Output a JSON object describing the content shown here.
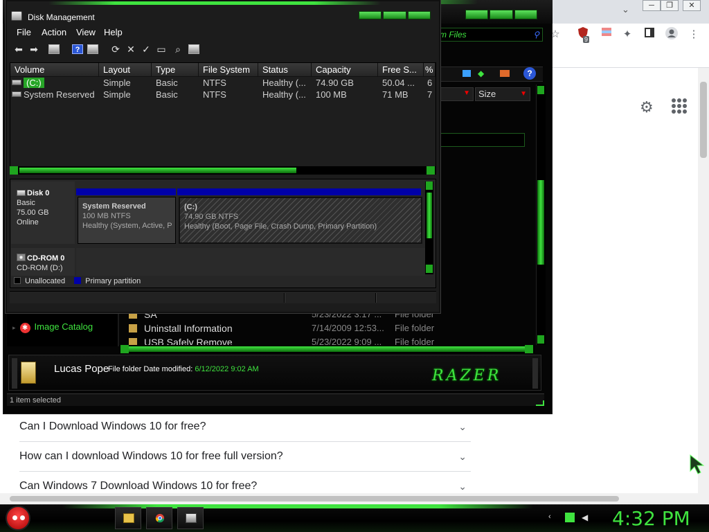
{
  "browser": {
    "win_controls": [
      "⌄",
      "─",
      "❐",
      "✕"
    ],
    "toolbar_icons": [
      "star-icon",
      "extension-shield-icon",
      "puzzle-icon",
      "sidebar-icon",
      "profile-icon",
      "kebab-menu-icon"
    ],
    "extension_badge": "9",
    "faqs": [
      {
        "q": "Can I Download Windows 10 for free?"
      },
      {
        "q": "How can I download Windows 10 for free full version?"
      },
      {
        "q": "Can Windows 7 Download Windows 10 for free?"
      }
    ]
  },
  "explorer": {
    "search_text": "m Files",
    "column_size": "Size",
    "nav_item": "Image Catalog",
    "files": [
      {
        "name": "SA",
        "date": "5/23/2022 3:17 ...",
        "type": "File folder"
      },
      {
        "name": "Uninstall Information",
        "date": "7/14/2009 12:53...",
        "type": "File folder"
      },
      {
        "name": "USB Safely Remove",
        "date": "5/23/2022 9:09 ...",
        "type": "File folder"
      }
    ],
    "details": {
      "name": "Lucas Pope",
      "meta_prefix": "File folder Date modified:",
      "date": "6/12/2022 9:02 AM"
    },
    "razer_logo": "RAZER",
    "status": "1 item selected"
  },
  "disk_management": {
    "title": "Disk Management",
    "menu": [
      "File",
      "Action",
      "View",
      "Help"
    ],
    "columns": [
      "Volume",
      "Layout",
      "Type",
      "File System",
      "Status",
      "Capacity",
      "Free S...",
      "%"
    ],
    "volumes": [
      {
        "volume": "(C:)",
        "layout": "Simple",
        "type": "Basic",
        "fs": "NTFS",
        "status": "Healthy (...",
        "capacity": "74.90 GB",
        "free": "50.04 ...",
        "pct": "6"
      },
      {
        "volume": "System Reserved",
        "layout": "Simple",
        "type": "Basic",
        "fs": "NTFS",
        "status": "Healthy (...",
        "capacity": "100 MB",
        "free": "71 MB",
        "pct": "7"
      }
    ],
    "disk0": {
      "name": "Disk 0",
      "kind": "Basic",
      "size": "75.00 GB",
      "state": "Online"
    },
    "partitions": [
      {
        "title": "System Reserved",
        "size": "100 MB NTFS",
        "status": "Healthy (System, Active, P"
      },
      {
        "title": "(C:)",
        "size": "74.90 GB NTFS",
        "status": "Healthy (Boot, Page File, Crash Dump, Primary Partition)"
      }
    ],
    "cdrom": {
      "name": "CD-ROM 0",
      "drive": "CD-ROM (D:)"
    },
    "legend": [
      {
        "label": "Unallocated",
        "color": "#000000"
      },
      {
        "label": "Primary partition",
        "color": "#0000a8"
      }
    ]
  },
  "taskbar": {
    "clock": "4:32 PM",
    "accent": "#3fe33f"
  }
}
